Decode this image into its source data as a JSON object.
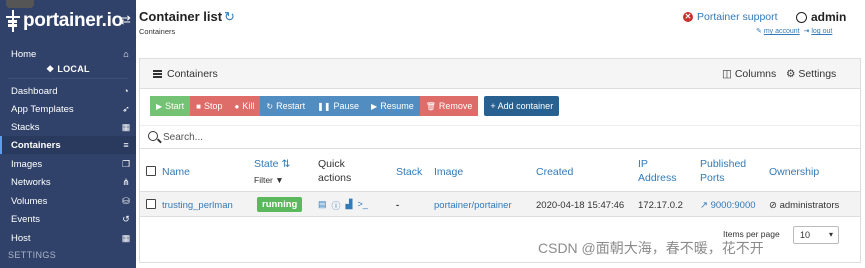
{
  "app": {
    "logo_text": "portainer.io",
    "toggle_icon": "toggle-arrows-icon"
  },
  "sidebar": {
    "items": [
      {
        "label": "Home",
        "icon": "home-icon",
        "glyph": "⌂"
      },
      {
        "label": "Dashboard",
        "icon": "dashboard-icon",
        "glyph": "◔"
      },
      {
        "label": "App Templates",
        "icon": "rocket-icon",
        "glyph": "➶"
      },
      {
        "label": "Stacks",
        "icon": "stacks-icon",
        "glyph": "▦"
      },
      {
        "label": "Containers",
        "icon": "containers-icon",
        "glyph": "≡"
      },
      {
        "label": "Images",
        "icon": "images-icon",
        "glyph": "❐"
      },
      {
        "label": "Networks",
        "icon": "networks-icon",
        "glyph": "⋔"
      },
      {
        "label": "Volumes",
        "icon": "volumes-icon",
        "glyph": "⛁"
      },
      {
        "label": "Events",
        "icon": "history-icon",
        "glyph": "↺"
      },
      {
        "label": "Host",
        "icon": "host-icon",
        "glyph": "▦"
      }
    ],
    "endpoint": "LOCAL",
    "settings_heading": "SETTINGS",
    "active": "Containers"
  },
  "header": {
    "title": "Container list",
    "subtitle": "Containers",
    "support_label": "Portainer support",
    "username": "admin",
    "my_account": "my account",
    "logout": "log out"
  },
  "panel": {
    "title": "Containers",
    "columns_label": "Columns",
    "settings_label": "Settings"
  },
  "actions": {
    "start": "Start",
    "stop": "Stop",
    "kill": "Kill",
    "restart": "Restart",
    "pause": "Pause",
    "resume": "Resume",
    "remove": "Remove",
    "add": "+ Add container"
  },
  "search": {
    "placeholder": "Search..."
  },
  "table": {
    "headers": {
      "name": "Name",
      "state": "State",
      "filter": "Filter",
      "quick_line1": "Quick",
      "quick_line2": "actions",
      "stack": "Stack",
      "image": "Image",
      "created": "Created",
      "ip_line1": "IP",
      "ip_line2": "Address",
      "ports_line1": "Published",
      "ports_line2": "Ports",
      "ownership": "Ownership"
    },
    "rows": [
      {
        "name": "trusting_perlman",
        "state": "running",
        "stack": "-",
        "image": "portainer/portainer",
        "created": "2020-04-18 15:47:46",
        "ip": "172.17.0.2",
        "ports": "9000:9000",
        "ownership": "administrators",
        "quick_actions": [
          "logs-icon",
          "inspect-icon",
          "stats-icon",
          "console-icon"
        ]
      }
    ]
  },
  "pagination": {
    "label": "Items per page",
    "value": "10"
  },
  "watermark": "CSDN @面朝大海，春不暖，花不开",
  "colors": {
    "sidebar": "#30426a",
    "primary": "#337ab7",
    "success": "#5cb85c",
    "danger": "#d9534f"
  }
}
